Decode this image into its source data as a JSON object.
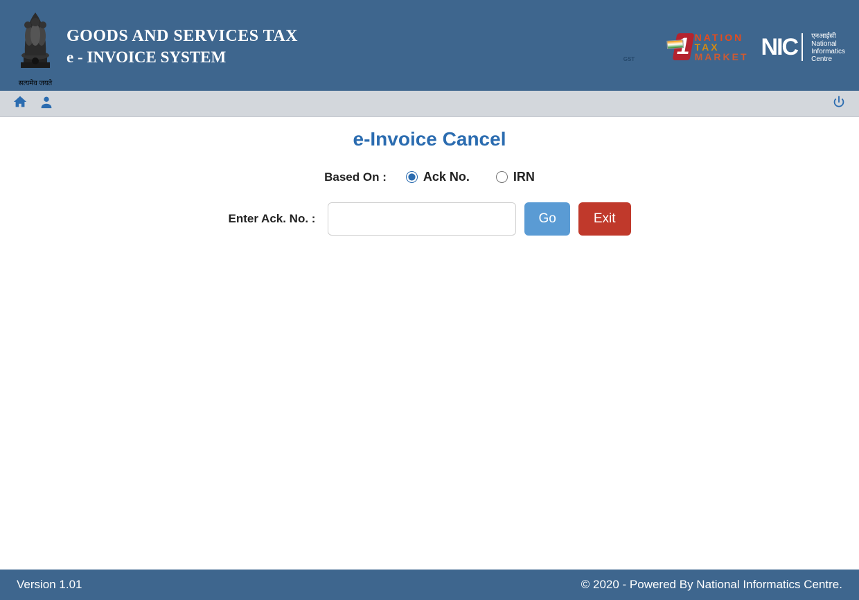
{
  "header": {
    "title_line1": "GOODS AND SERVICES TAX",
    "title_line2": "e - INVOICE SYSTEM",
    "emblem_caption": "सत्यमेव जयते",
    "ntm_text1": "NATION",
    "ntm_text2": "TAX",
    "ntm_text3": "MARKET",
    "ntm_number": "1",
    "ntm_gst": "GST",
    "nic_big": "NIC",
    "nic_hi": "एनआईसी",
    "nic_en1": "National",
    "nic_en2": "Informatics",
    "nic_en3": "Centre"
  },
  "iconbar": {
    "home_icon": "home-icon",
    "user_icon": "user-icon",
    "power_icon": "power-icon"
  },
  "page": {
    "title": "e-Invoice Cancel",
    "based_on_label": "Based On :",
    "radio_ack": "Ack No.",
    "radio_irn": "IRN",
    "selected": "ack",
    "entry_label": "Enter Ack. No. :",
    "entry_value": "",
    "btn_go": "Go",
    "btn_exit": "Exit"
  },
  "footer": {
    "version": "Version 1.01",
    "copyright": "© 2020 - Powered By National Informatics Centre."
  }
}
